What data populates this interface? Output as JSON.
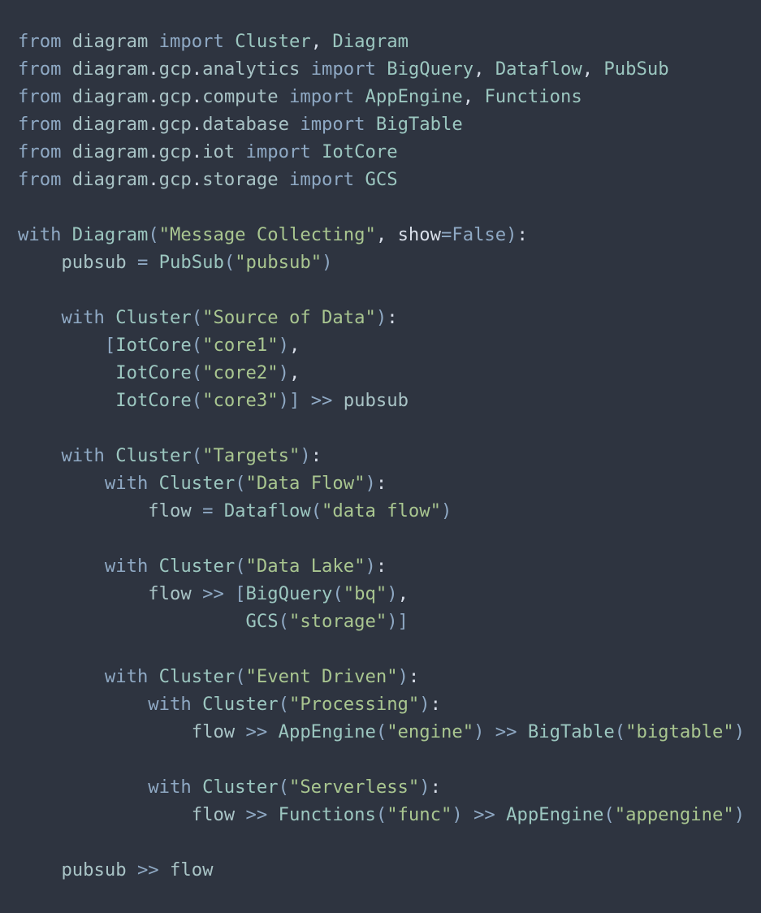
{
  "colors": {
    "background": "#2e3440",
    "keyword": "#8fa9c4",
    "identifier": "#a9c4c6",
    "string": "#a9c690",
    "punctuation": "#d8dee9"
  },
  "lines": [
    [
      [
        "kw",
        "from"
      ],
      [
        "pl",
        " "
      ],
      [
        "mod",
        "diagram"
      ],
      [
        "pl",
        " "
      ],
      [
        "kw",
        "import"
      ],
      [
        "pl",
        " "
      ],
      [
        "cls",
        "Cluster"
      ],
      [
        "pl",
        ", "
      ],
      [
        "cls",
        "Diagram"
      ]
    ],
    [
      [
        "kw",
        "from"
      ],
      [
        "pl",
        " "
      ],
      [
        "mod",
        "diagram"
      ],
      [
        "dot",
        "."
      ],
      [
        "mod",
        "gcp"
      ],
      [
        "dot",
        "."
      ],
      [
        "mod",
        "analytics"
      ],
      [
        "pl",
        " "
      ],
      [
        "kw",
        "import"
      ],
      [
        "pl",
        " "
      ],
      [
        "cls",
        "BigQuery"
      ],
      [
        "pl",
        ", "
      ],
      [
        "cls",
        "Dataflow"
      ],
      [
        "pl",
        ", "
      ],
      [
        "cls",
        "PubSub"
      ]
    ],
    [
      [
        "kw",
        "from"
      ],
      [
        "pl",
        " "
      ],
      [
        "mod",
        "diagram"
      ],
      [
        "dot",
        "."
      ],
      [
        "mod",
        "gcp"
      ],
      [
        "dot",
        "."
      ],
      [
        "mod",
        "compute"
      ],
      [
        "pl",
        " "
      ],
      [
        "kw",
        "import"
      ],
      [
        "pl",
        " "
      ],
      [
        "cls",
        "AppEngine"
      ],
      [
        "pl",
        ", "
      ],
      [
        "cls",
        "Functions"
      ]
    ],
    [
      [
        "kw",
        "from"
      ],
      [
        "pl",
        " "
      ],
      [
        "mod",
        "diagram"
      ],
      [
        "dot",
        "."
      ],
      [
        "mod",
        "gcp"
      ],
      [
        "dot",
        "."
      ],
      [
        "mod",
        "database"
      ],
      [
        "pl",
        " "
      ],
      [
        "kw",
        "import"
      ],
      [
        "pl",
        " "
      ],
      [
        "cls",
        "BigTable"
      ]
    ],
    [
      [
        "kw",
        "from"
      ],
      [
        "pl",
        " "
      ],
      [
        "mod",
        "diagram"
      ],
      [
        "dot",
        "."
      ],
      [
        "mod",
        "gcp"
      ],
      [
        "dot",
        "."
      ],
      [
        "mod",
        "iot"
      ],
      [
        "pl",
        " "
      ],
      [
        "kw",
        "import"
      ],
      [
        "pl",
        " "
      ],
      [
        "cls",
        "IotCore"
      ]
    ],
    [
      [
        "kw",
        "from"
      ],
      [
        "pl",
        " "
      ],
      [
        "mod",
        "diagram"
      ],
      [
        "dot",
        "."
      ],
      [
        "mod",
        "gcp"
      ],
      [
        "dot",
        "."
      ],
      [
        "mod",
        "storage"
      ],
      [
        "pl",
        " "
      ],
      [
        "kw",
        "import"
      ],
      [
        "pl",
        " "
      ],
      [
        "cls",
        "GCS"
      ]
    ],
    [],
    [
      [
        "kw",
        "with"
      ],
      [
        "pl",
        " "
      ],
      [
        "cls",
        "Diagram"
      ],
      [
        "par",
        "("
      ],
      [
        "str",
        "\"Message Collecting\""
      ],
      [
        "pl",
        ", "
      ],
      [
        "kwarg",
        "show"
      ],
      [
        "op",
        "="
      ],
      [
        "const",
        "False"
      ],
      [
        "par",
        ")"
      ],
      [
        "pl",
        ":"
      ]
    ],
    [
      [
        "pl",
        "    "
      ],
      [
        "ident",
        "pubsub"
      ],
      [
        "pl",
        " "
      ],
      [
        "op",
        "="
      ],
      [
        "pl",
        " "
      ],
      [
        "cls",
        "PubSub"
      ],
      [
        "par",
        "("
      ],
      [
        "str",
        "\"pubsub\""
      ],
      [
        "par",
        ")"
      ]
    ],
    [],
    [
      [
        "pl",
        "    "
      ],
      [
        "kw",
        "with"
      ],
      [
        "pl",
        " "
      ],
      [
        "cls",
        "Cluster"
      ],
      [
        "par",
        "("
      ],
      [
        "str",
        "\"Source of Data\""
      ],
      [
        "par",
        ")"
      ],
      [
        "pl",
        ":"
      ]
    ],
    [
      [
        "pl",
        "        "
      ],
      [
        "par",
        "["
      ],
      [
        "cls",
        "IotCore"
      ],
      [
        "par",
        "("
      ],
      [
        "str",
        "\"core1\""
      ],
      [
        "par",
        ")"
      ],
      [
        "pl",
        ","
      ]
    ],
    [
      [
        "pl",
        "         "
      ],
      [
        "cls",
        "IotCore"
      ],
      [
        "par",
        "("
      ],
      [
        "str",
        "\"core2\""
      ],
      [
        "par",
        ")"
      ],
      [
        "pl",
        ","
      ]
    ],
    [
      [
        "pl",
        "         "
      ],
      [
        "cls",
        "IotCore"
      ],
      [
        "par",
        "("
      ],
      [
        "str",
        "\"core3\""
      ],
      [
        "par",
        ")]"
      ],
      [
        "pl",
        " "
      ],
      [
        "op",
        ">>"
      ],
      [
        "pl",
        " "
      ],
      [
        "ident",
        "pubsub"
      ]
    ],
    [],
    [
      [
        "pl",
        "    "
      ],
      [
        "kw",
        "with"
      ],
      [
        "pl",
        " "
      ],
      [
        "cls",
        "Cluster"
      ],
      [
        "par",
        "("
      ],
      [
        "str",
        "\"Targets\""
      ],
      [
        "par",
        ")"
      ],
      [
        "pl",
        ":"
      ]
    ],
    [
      [
        "pl",
        "        "
      ],
      [
        "kw",
        "with"
      ],
      [
        "pl",
        " "
      ],
      [
        "cls",
        "Cluster"
      ],
      [
        "par",
        "("
      ],
      [
        "str",
        "\"Data Flow\""
      ],
      [
        "par",
        ")"
      ],
      [
        "pl",
        ":"
      ]
    ],
    [
      [
        "pl",
        "            "
      ],
      [
        "ident",
        "flow"
      ],
      [
        "pl",
        " "
      ],
      [
        "op",
        "="
      ],
      [
        "pl",
        " "
      ],
      [
        "cls",
        "Dataflow"
      ],
      [
        "par",
        "("
      ],
      [
        "str",
        "\"data flow\""
      ],
      [
        "par",
        ")"
      ]
    ],
    [],
    [
      [
        "pl",
        "        "
      ],
      [
        "kw",
        "with"
      ],
      [
        "pl",
        " "
      ],
      [
        "cls",
        "Cluster"
      ],
      [
        "par",
        "("
      ],
      [
        "str",
        "\"Data Lake\""
      ],
      [
        "par",
        ")"
      ],
      [
        "pl",
        ":"
      ]
    ],
    [
      [
        "pl",
        "            "
      ],
      [
        "ident",
        "flow"
      ],
      [
        "pl",
        " "
      ],
      [
        "op",
        ">>"
      ],
      [
        "pl",
        " "
      ],
      [
        "par",
        "["
      ],
      [
        "cls",
        "BigQuery"
      ],
      [
        "par",
        "("
      ],
      [
        "str",
        "\"bq\""
      ],
      [
        "par",
        ")"
      ],
      [
        "pl",
        ","
      ]
    ],
    [
      [
        "pl",
        "                     "
      ],
      [
        "cls",
        "GCS"
      ],
      [
        "par",
        "("
      ],
      [
        "str",
        "\"storage\""
      ],
      [
        "par",
        ")]"
      ]
    ],
    [],
    [
      [
        "pl",
        "        "
      ],
      [
        "kw",
        "with"
      ],
      [
        "pl",
        " "
      ],
      [
        "cls",
        "Cluster"
      ],
      [
        "par",
        "("
      ],
      [
        "str",
        "\"Event Driven\""
      ],
      [
        "par",
        ")"
      ],
      [
        "pl",
        ":"
      ]
    ],
    [
      [
        "pl",
        "            "
      ],
      [
        "kw",
        "with"
      ],
      [
        "pl",
        " "
      ],
      [
        "cls",
        "Cluster"
      ],
      [
        "par",
        "("
      ],
      [
        "str",
        "\"Processing\""
      ],
      [
        "par",
        ")"
      ],
      [
        "pl",
        ":"
      ]
    ],
    [
      [
        "pl",
        "                "
      ],
      [
        "ident",
        "flow"
      ],
      [
        "pl",
        " "
      ],
      [
        "op",
        ">>"
      ],
      [
        "pl",
        " "
      ],
      [
        "cls",
        "AppEngine"
      ],
      [
        "par",
        "("
      ],
      [
        "str",
        "\"engine\""
      ],
      [
        "par",
        ")"
      ],
      [
        "pl",
        " "
      ],
      [
        "op",
        ">>"
      ],
      [
        "pl",
        " "
      ],
      [
        "cls",
        "BigTable"
      ],
      [
        "par",
        "("
      ],
      [
        "str",
        "\"bigtable\""
      ],
      [
        "par",
        ")"
      ]
    ],
    [],
    [
      [
        "pl",
        "            "
      ],
      [
        "kw",
        "with"
      ],
      [
        "pl",
        " "
      ],
      [
        "cls",
        "Cluster"
      ],
      [
        "par",
        "("
      ],
      [
        "str",
        "\"Serverless\""
      ],
      [
        "par",
        ")"
      ],
      [
        "pl",
        ":"
      ]
    ],
    [
      [
        "pl",
        "                "
      ],
      [
        "ident",
        "flow"
      ],
      [
        "pl",
        " "
      ],
      [
        "op",
        ">>"
      ],
      [
        "pl",
        " "
      ],
      [
        "cls",
        "Functions"
      ],
      [
        "par",
        "("
      ],
      [
        "str",
        "\"func\""
      ],
      [
        "par",
        ")"
      ],
      [
        "pl",
        " "
      ],
      [
        "op",
        ">>"
      ],
      [
        "pl",
        " "
      ],
      [
        "cls",
        "AppEngine"
      ],
      [
        "par",
        "("
      ],
      [
        "str",
        "\"appengine\""
      ],
      [
        "par",
        ")"
      ]
    ],
    [],
    [
      [
        "pl",
        "    "
      ],
      [
        "ident",
        "pubsub"
      ],
      [
        "pl",
        " "
      ],
      [
        "op",
        ">>"
      ],
      [
        "pl",
        " "
      ],
      [
        "ident",
        "flow"
      ]
    ]
  ]
}
